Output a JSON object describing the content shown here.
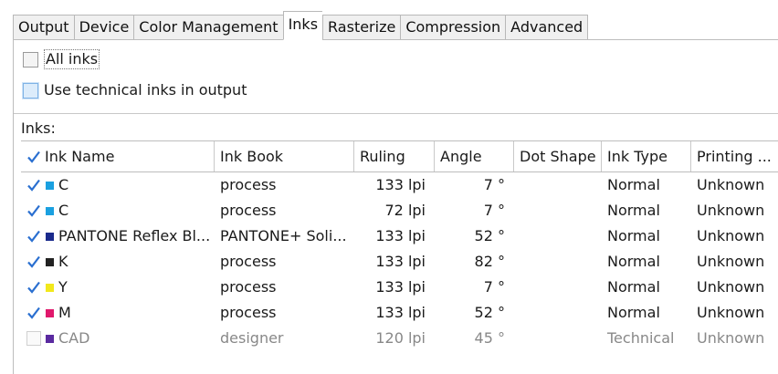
{
  "tabs": [
    "Output",
    "Device",
    "Color Management",
    "Inks",
    "Rasterize",
    "Compression",
    "Advanced"
  ],
  "active_tab": "Inks",
  "options": {
    "all_inks": "All inks",
    "technical_inks": "Use technical inks in output"
  },
  "inks_label": "Inks:",
  "columns": [
    "Ink Name",
    "Ink Book",
    "Ruling",
    "Angle",
    "Dot Shape",
    "Ink Type",
    "Printing ..."
  ],
  "rows": [
    {
      "checked": true,
      "color": "#1aa0e0",
      "name": "C",
      "book": "process",
      "ruling": "133 lpi",
      "angle": "7 °",
      "dot": "",
      "type": "Normal",
      "printing": "Unknown"
    },
    {
      "checked": true,
      "color": "#1aa0e0",
      "name": "C",
      "book": "process",
      "ruling": "72 lpi",
      "angle": "7 °",
      "dot": "",
      "type": "Normal",
      "printing": "Unknown"
    },
    {
      "checked": true,
      "color": "#1a2a8c",
      "name": "PANTONE Reflex Bl...",
      "book": "PANTONE+ Soli...",
      "ruling": "133 lpi",
      "angle": "52 °",
      "dot": "",
      "type": "Normal",
      "printing": "Unknown"
    },
    {
      "checked": true,
      "color": "#222222",
      "name": "K",
      "book": "process",
      "ruling": "133 lpi",
      "angle": "82 °",
      "dot": "",
      "type": "Normal",
      "printing": "Unknown"
    },
    {
      "checked": true,
      "color": "#f2e81c",
      "name": "Y",
      "book": "process",
      "ruling": "133 lpi",
      "angle": "7 °",
      "dot": "",
      "type": "Normal",
      "printing": "Unknown"
    },
    {
      "checked": true,
      "color": "#e0186c",
      "name": "M",
      "book": "process",
      "ruling": "133 lpi",
      "angle": "52 °",
      "dot": "",
      "type": "Normal",
      "printing": "Unknown"
    },
    {
      "checked": false,
      "color": "#5a2aa0",
      "name": "CAD",
      "book": "designer",
      "ruling": "120 lpi",
      "angle": "45 °",
      "dot": "",
      "type": "Technical",
      "printing": "Unknown",
      "disabled": true
    }
  ]
}
